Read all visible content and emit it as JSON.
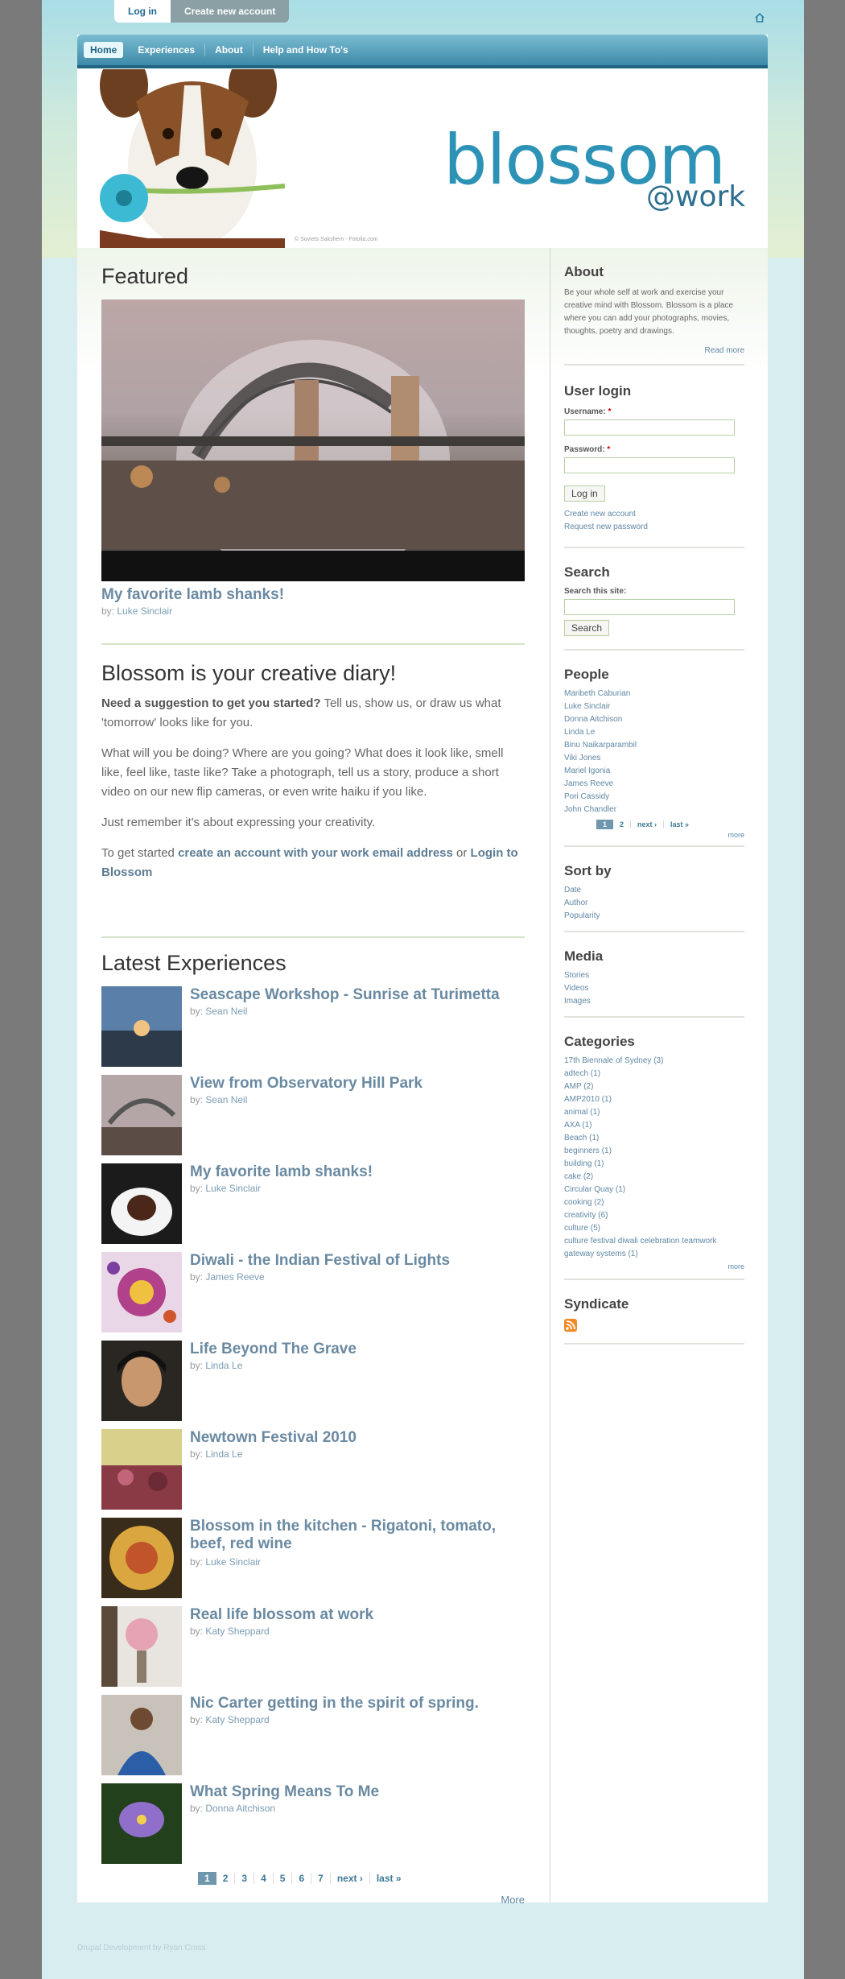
{
  "topbar": {
    "login": "Log in",
    "create": "Create new account"
  },
  "nav": {
    "items": [
      "Home",
      "Experiences",
      "About",
      "Help and How To's"
    ]
  },
  "banner": {
    "logo_big": "blossom",
    "logo_work": "@work",
    "credit": "© Soviets Sakshem - Fotolia.com"
  },
  "featured": {
    "heading": "Featured",
    "title": "My favorite lamb shanks!",
    "by_prefix": "by:",
    "author": "Luke Sinclair"
  },
  "diary": {
    "heading": "Blossom is your creative diary!",
    "p1_lead": "Need a suggestion to get you started?",
    "p1_rest": " Tell us, show us, or draw us what 'tomorrow' looks like for you.",
    "p2": "What will you be doing? Where are you going? What does it look like, smell like, feel like, taste like? Take a photograph, tell us a story, produce a short video on our new flip cameras, or even write haiku if you like.",
    "p3": "Just remember it's about expressing your creativity.",
    "p4_a": "To get started ",
    "p4_link1": "create an account with your work email address",
    "p4_b": " or ",
    "p4_link2": "Login to Blossom"
  },
  "latest": {
    "heading": "Latest Experiences",
    "items": [
      {
        "title": "Seascape Workshop - Sunrise at Turimetta",
        "author": "Sean Neil"
      },
      {
        "title": "View from Observatory Hill Park",
        "author": "Sean Neil"
      },
      {
        "title": "My favorite lamb shanks!",
        "author": "Luke Sinclair"
      },
      {
        "title": "Diwali - the Indian Festival of Lights",
        "author": "James Reeve"
      },
      {
        "title": "Life Beyond The Grave",
        "author": "Linda Le"
      },
      {
        "title": "Newtown Festival 2010",
        "author": "Linda Le"
      },
      {
        "title": "Blossom in the kitchen - Rigatoni, tomato, beef, red wine",
        "author": "Luke Sinclair"
      },
      {
        "title": "Real life blossom at work",
        "author": "Katy Sheppard"
      },
      {
        "title": "Nic Carter getting in the spirit of spring.",
        "author": "Katy Sheppard"
      },
      {
        "title": "What Spring Means To Me",
        "author": "Donna Aitchison"
      }
    ],
    "pager": [
      "1",
      "2",
      "3",
      "4",
      "5",
      "6",
      "7",
      "next ›",
      "last »"
    ],
    "more": "More"
  },
  "sidebar": {
    "about": {
      "heading": "About",
      "text": "Be your whole self at work and exercise your creative mind with Blossom. Blossom is a place where you can add your photographs, movies, thoughts, poetry and drawings.",
      "read_more": "Read more"
    },
    "login": {
      "heading": "User login",
      "username_label": "Username:",
      "password_label": "Password:",
      "required": "*",
      "button": "Log in",
      "create": "Create new account",
      "request": "Request new password"
    },
    "search": {
      "heading": "Search",
      "label": "Search this site:",
      "button": "Search"
    },
    "people": {
      "heading": "People",
      "items": [
        "Maribeth Caburian",
        "Luke Sinclair",
        "Donna Aitchison",
        "Linda Le",
        "Binu Naikarparambil",
        "Viki Jones",
        "Mariel Igonia",
        "James Reeve",
        "Pori Cassidy",
        "John Chandler"
      ],
      "pager": [
        "1",
        "2",
        "next ›",
        "last »"
      ],
      "more": "more"
    },
    "sort": {
      "heading": "Sort by",
      "items": [
        "Date",
        "Author",
        "Popularity"
      ]
    },
    "media": {
      "heading": "Media",
      "items": [
        "Stories",
        "Videos",
        "Images"
      ]
    },
    "categories": {
      "heading": "Categories",
      "items": [
        "17th Biennale of Sydney (3)",
        "adtech (1)",
        "AMP (2)",
        "AMP2010 (1)",
        "animal (1)",
        "AXA (1)",
        "Beach (1)",
        "beginners (1)",
        "building (1)",
        "cake (2)",
        "Circular Quay (1)",
        "cooking (2)",
        "creativity (6)",
        "culture (5)",
        "culture festival diwali celebration teamwork",
        "gateway systems (1)"
      ],
      "more": "more"
    },
    "syndicate": {
      "heading": "Syndicate"
    }
  },
  "footer": {
    "text": "Drupal Development by Ryan Cross"
  }
}
